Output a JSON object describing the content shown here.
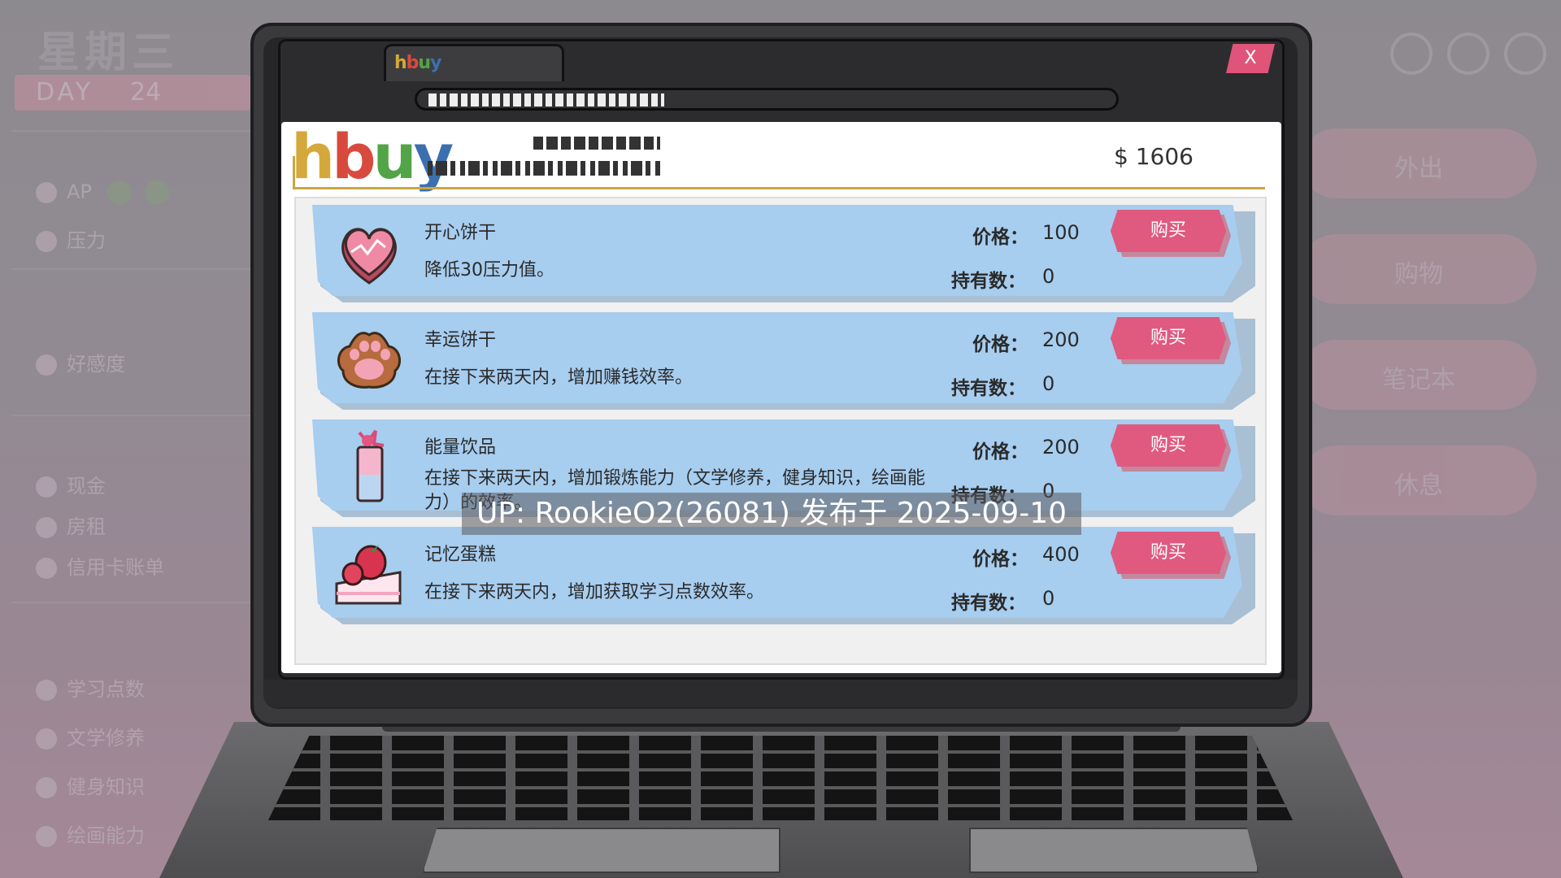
{
  "background_ui": {
    "weekday": "星期三",
    "day_label": "DAY",
    "day_number": "24",
    "stats": [
      "AP",
      "压力",
      "好感度",
      "现金",
      "房租",
      "信用卡账单",
      "学习点数",
      "文学修养",
      "健身知识",
      "绘画能力"
    ],
    "right_buttons": [
      "外出",
      "购物",
      "笔记本",
      "休息"
    ]
  },
  "browser": {
    "tab_logo": "hbuy",
    "close_label": "X"
  },
  "site": {
    "logo_letters": [
      "h",
      "b",
      "u",
      "y"
    ],
    "logo_colors": [
      "#d4a83a",
      "#d84a3d",
      "#52a447",
      "#3c6fb0"
    ],
    "money": "$ 1606"
  },
  "items": [
    {
      "name": "开心饼干",
      "desc": "降低30压力值。",
      "price_label": "价格：",
      "price": "100",
      "owned_label": "持有数：",
      "owned": "0",
      "buy_label": "购买",
      "icon": "heart-cookie-icon"
    },
    {
      "name": "幸运饼干",
      "desc": "在接下来两天内，增加赚钱效率。",
      "price_label": "价格：",
      "price": "200",
      "owned_label": "持有数：",
      "owned": "0",
      "buy_label": "购买",
      "icon": "paw-cookie-icon"
    },
    {
      "name": "能量饮品",
      "desc": "在接下来两天内，增加锻炼能力（文学修养，健身知识，绘画能力）的效率。",
      "price_label": "价格：",
      "price": "200",
      "owned_label": "持有数：",
      "owned": "0",
      "buy_label": "购买",
      "icon": "energy-drink-icon"
    },
    {
      "name": "记忆蛋糕",
      "desc": "在接下来两天内，增加获取学习点数效率。",
      "price_label": "价格：",
      "price": "400",
      "owned_label": "持有数：",
      "owned": "0",
      "buy_label": "购买",
      "icon": "strawberry-cake-icon"
    }
  ],
  "watermark": "UP: RookieO2(26081) 发布于 2025-09-10",
  "colors": {
    "card": "#a7cdef",
    "buy_button": "#e05a80",
    "close_button": "#e05479",
    "header_line": "#c9a640"
  }
}
